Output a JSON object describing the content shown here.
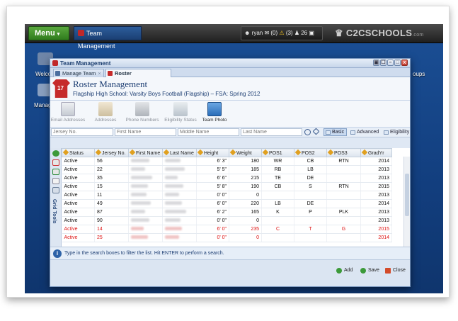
{
  "topbar": {
    "menu_label": "Menu",
    "active_app": "Team Management",
    "user": "ryan",
    "mail_count": "(0)",
    "alert_count": "(3)",
    "online_count": "26",
    "logo": "C2CSCHOOLS",
    "logo_suffix": ".com"
  },
  "desktop": {
    "labels": [
      "Welco",
      "Manage",
      "oups"
    ]
  },
  "window": {
    "title": "Team Management",
    "controls": [
      "▣",
      "☐",
      "–",
      "□",
      "x"
    ],
    "tabs": [
      {
        "label": "Manage Team",
        "close": "×"
      },
      {
        "label": "Roster Management",
        "close": "×"
      }
    ],
    "header": {
      "title": "Roster Management",
      "subtitle": "Flagship High School: Varsity Boys Football (Flagship) – FSA: Spring 2012",
      "jersey_number": "17"
    },
    "toolbar": [
      {
        "label": "Email Addresses",
        "icon": "envelope-icon",
        "enabled": false
      },
      {
        "label": "Addresses",
        "icon": "map-icon",
        "enabled": false
      },
      {
        "label": "Phone Numbers",
        "icon": "phone-icon",
        "enabled": false
      },
      {
        "label": "Eligibility Status",
        "icon": "clipboard-check-icon",
        "enabled": false
      },
      {
        "label": "Team Photo",
        "icon": "photo-icon",
        "enabled": true
      }
    ],
    "search": {
      "jersey_placeholder": "Jersey No.",
      "first_placeholder": "First Name",
      "middle_placeholder": "Middle Name",
      "last_placeholder": "Last Name",
      "basic": "Basic",
      "advanced": "Advanced",
      "eligibility": "Eligibility"
    },
    "grid": {
      "tools_label": "Grid Tools",
      "columns": [
        "Status",
        "Jersey No.",
        "First Name",
        "Last Name",
        "Height",
        "Weight",
        "POS1",
        "POS2",
        "POS3",
        "GradYr"
      ],
      "rows": [
        {
          "status": "Active",
          "jersey": "56",
          "height": "6' 3\"",
          "weight": "180",
          "pos1": "WR",
          "pos2": "CB",
          "pos3": "RTN",
          "grad": "2014",
          "red": false
        },
        {
          "status": "Active",
          "jersey": "22",
          "height": "5' 5\"",
          "weight": "185",
          "pos1": "RB",
          "pos2": "LB",
          "pos3": "",
          "grad": "2013",
          "red": false
        },
        {
          "status": "Active",
          "jersey": "35",
          "height": "6' 6\"",
          "weight": "215",
          "pos1": "TE",
          "pos2": "DE",
          "pos3": "",
          "grad": "2013",
          "red": false
        },
        {
          "status": "Active",
          "jersey": "15",
          "height": "5' 8\"",
          "weight": "190",
          "pos1": "CB",
          "pos2": "S",
          "pos3": "RTN",
          "grad": "2015",
          "red": false
        },
        {
          "status": "Active",
          "jersey": "11",
          "height": "0' 0\"",
          "weight": "0",
          "pos1": "",
          "pos2": "",
          "pos3": "",
          "grad": "2013",
          "red": false
        },
        {
          "status": "Active",
          "jersey": "49",
          "height": "6' 0\"",
          "weight": "220",
          "pos1": "LB",
          "pos2": "DE",
          "pos3": "",
          "grad": "2014",
          "red": false
        },
        {
          "status": "Active",
          "jersey": "87",
          "height": "6' 2\"",
          "weight": "165",
          "pos1": "K",
          "pos2": "P",
          "pos3": "PLK",
          "grad": "2013",
          "red": false
        },
        {
          "status": "Active",
          "jersey": "90",
          "height": "0' 0\"",
          "weight": "0",
          "pos1": "",
          "pos2": "",
          "pos3": "",
          "grad": "2013",
          "red": false
        },
        {
          "status": "Active",
          "jersey": "14",
          "height": "6' 0\"",
          "weight": "235",
          "pos1": "C",
          "pos2": "T",
          "pos3": "G",
          "grad": "2015",
          "red": true
        },
        {
          "status": "Active",
          "jersey": "25",
          "height": "0' 0\"",
          "weight": "0",
          "pos1": "",
          "pos2": "",
          "pos3": "",
          "grad": "2014",
          "red": true
        }
      ]
    },
    "info": "Type in the search boxes to filter the list. Hit ENTER to perform a search.",
    "buttons": {
      "add": "Add",
      "save": "Save",
      "close": "Close"
    },
    "colors": {
      "accent": "#1c3d72",
      "error": "#dd1111",
      "jersey": "#c62b2b"
    }
  }
}
